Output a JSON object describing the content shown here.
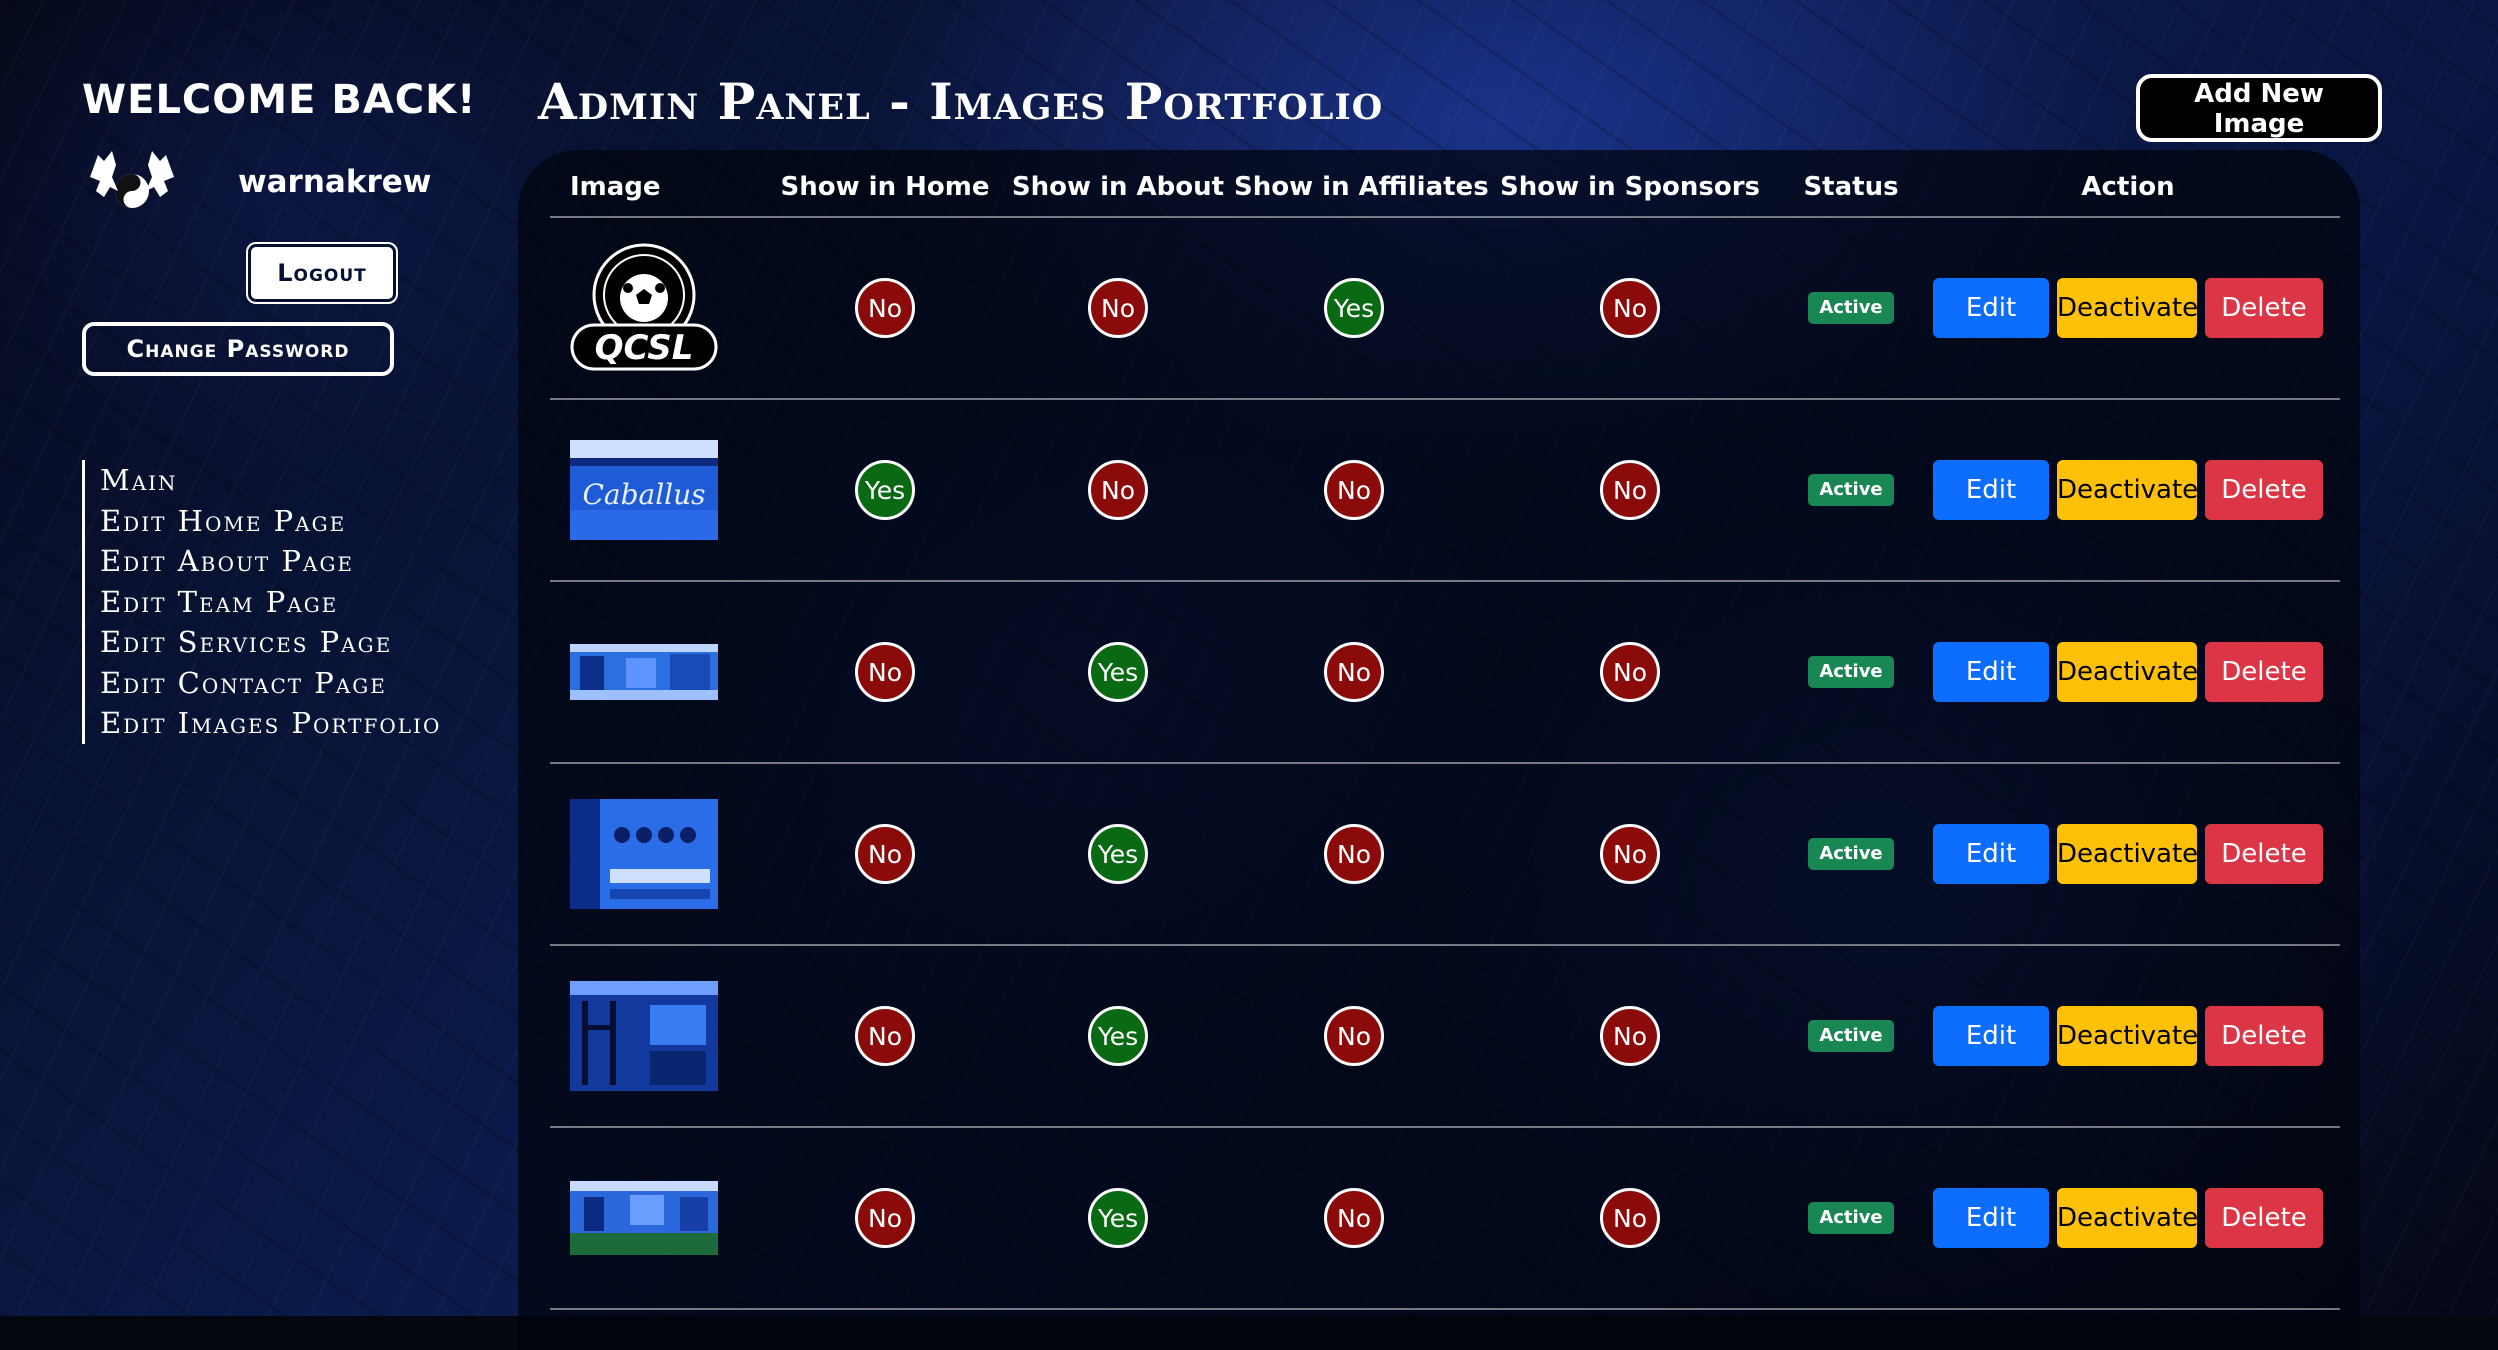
{
  "sidebar": {
    "welcome": "Welcome Back!",
    "username": "warnakrew",
    "logout_label": "Logout",
    "change_password_label": "Change Password",
    "nav": [
      "Main",
      "Edit Home Page",
      "Edit About Page",
      "Edit Team Page",
      "Edit Services Page",
      "Edit Contact Page",
      "Edit Images Portfolio"
    ]
  },
  "header": {
    "title": "Admin Panel - Images Portfolio",
    "add_button_label": "Add New Image"
  },
  "table": {
    "headers": [
      "Image",
      "Show in Home",
      "Show in About",
      "Show in Affiliates",
      "Show in Sponsors",
      "Status",
      "Action"
    ],
    "rows": [
      {
        "thumb": "qcsl-logo",
        "logo_text": "QCSL",
        "home": "No",
        "about": "No",
        "affiliates": "Yes",
        "sponsors": "No",
        "status": "Active"
      },
      {
        "thumb": "caballus-sign",
        "logo_text": "Caballus",
        "home": "Yes",
        "about": "No",
        "affiliates": "No",
        "sponsors": "No",
        "status": "Active"
      },
      {
        "thumb": "gym-hallway",
        "home": "No",
        "about": "Yes",
        "affiliates": "No",
        "sponsors": "No",
        "status": "Active"
      },
      {
        "thumb": "gym-weights-wall",
        "home": "No",
        "about": "Yes",
        "affiliates": "No",
        "sponsors": "No",
        "status": "Active"
      },
      {
        "thumb": "gym-racks",
        "home": "No",
        "about": "Yes",
        "affiliates": "No",
        "sponsors": "No",
        "status": "Active"
      },
      {
        "thumb": "gym-turf",
        "home": "No",
        "about": "Yes",
        "affiliates": "No",
        "sponsors": "No",
        "status": "Active"
      }
    ],
    "actions": {
      "edit": "Edit",
      "deactivate": "Deactivate",
      "delete": "Delete"
    }
  },
  "colors": {
    "yes": "#0a6a14",
    "no": "#8b0a0a",
    "active_badge": "#198754",
    "edit": "#0d6efd",
    "deactivate": "#ffc107",
    "delete": "#dc3545"
  }
}
